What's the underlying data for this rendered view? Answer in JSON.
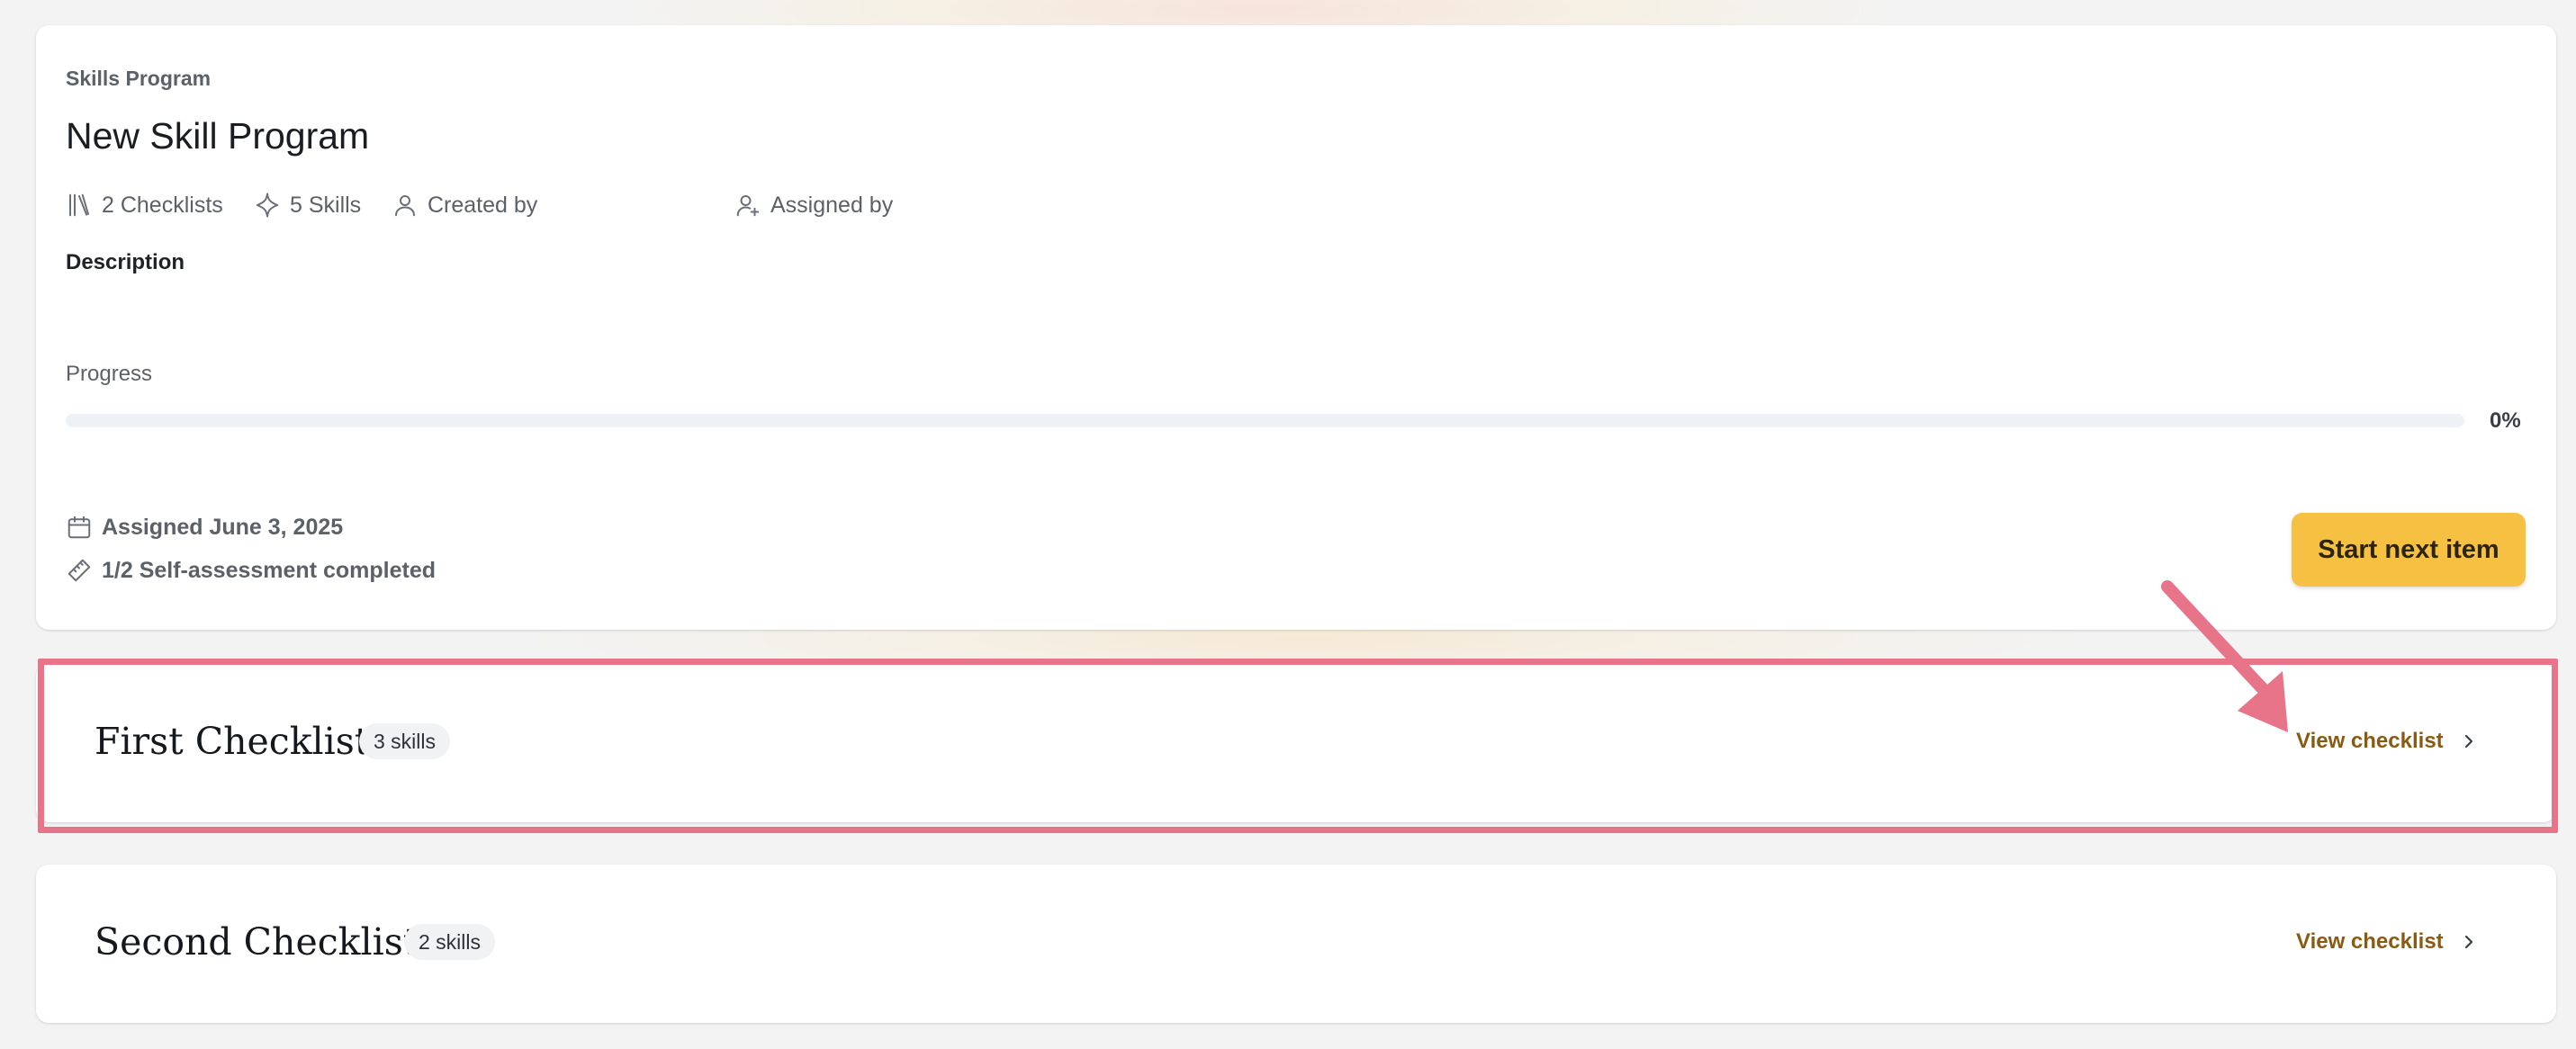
{
  "program": {
    "eyebrow": "Skills Program",
    "title": "New Skill Program",
    "meta": {
      "checklists": "2 Checklists",
      "skills": "5 Skills",
      "created_by": "Created by",
      "assigned_by": "Assigned by"
    },
    "description_label": "Description",
    "progress_label": "Progress",
    "progress_fraction": 0,
    "progress_percent": "0%",
    "assigned_date": "Assigned June 3, 2025",
    "self_assessment": "1/2 Self-assessment completed",
    "start_button": "Start next item"
  },
  "checklists": [
    {
      "name": "First Checklist",
      "skills": "3 skills",
      "link": "View checklist"
    },
    {
      "name": "Second Checklist",
      "skills": "2 skills",
      "link": "View checklist"
    }
  ],
  "colors": {
    "accent": "#f6c142",
    "link": "#8a5a12",
    "highlight": "#e8748a"
  },
  "icons": {
    "checklists": "books-icon",
    "skills": "sparkle-icon",
    "created_by": "user-icon",
    "assigned_by": "user-plus-icon",
    "date": "calendar-icon",
    "self_assessment": "ruler-icon",
    "link": "chevron-right-icon"
  }
}
